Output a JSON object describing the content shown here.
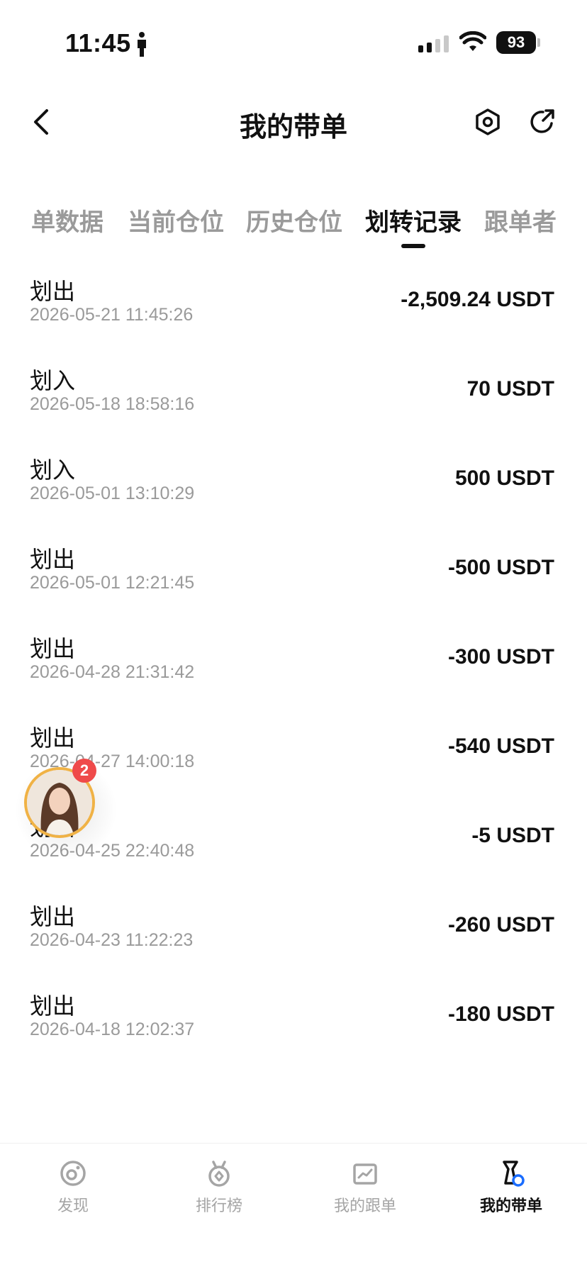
{
  "status_bar": {
    "time": "11:45",
    "battery": "93"
  },
  "header": {
    "title": "我的带单"
  },
  "tabs": [
    {
      "label": "单数据",
      "active": false
    },
    {
      "label": "当前仓位",
      "active": false
    },
    {
      "label": "历史仓位",
      "active": false
    },
    {
      "label": "划转记录",
      "active": true
    },
    {
      "label": "跟单者",
      "active": false
    }
  ],
  "records": [
    {
      "type": "划出",
      "time": "2026-05-21 11:45:26",
      "amount": "-2,509.24 USDT"
    },
    {
      "type": "划入",
      "time": "2026-05-18 18:58:16",
      "amount": "70 USDT"
    },
    {
      "type": "划入",
      "time": "2026-05-01 13:10:29",
      "amount": "500 USDT"
    },
    {
      "type": "划出",
      "time": "2026-05-01 12:21:45",
      "amount": "-500 USDT"
    },
    {
      "type": "划出",
      "time": "2026-04-28 21:31:42",
      "amount": "-300 USDT"
    },
    {
      "type": "划出",
      "time": "2026-04-27 14:00:18",
      "amount": "-540 USDT"
    },
    {
      "type": "划出",
      "time": "2026-04-25 22:40:48",
      "amount": "-5 USDT"
    },
    {
      "type": "划出",
      "time": "2026-04-23 11:22:23",
      "amount": "-260 USDT"
    },
    {
      "type": "划出",
      "time": "2026-04-18 12:02:37",
      "amount": "-180 USDT"
    }
  ],
  "floating_avatar": {
    "badge": "2"
  },
  "bottom_nav": [
    {
      "label": "发现",
      "icon": "discover-icon",
      "active": false
    },
    {
      "label": "排行榜",
      "icon": "ranking-medal-icon",
      "active": false
    },
    {
      "label": "我的跟单",
      "icon": "follow-chart-icon",
      "active": false
    },
    {
      "label": "我的带单",
      "icon": "lead-trade-icon",
      "active": true
    }
  ],
  "colors": {
    "accent": "#1a6dff",
    "badge": "#ef4a4a",
    "ring": "#f0b245",
    "muted": "#9a9a9a"
  }
}
